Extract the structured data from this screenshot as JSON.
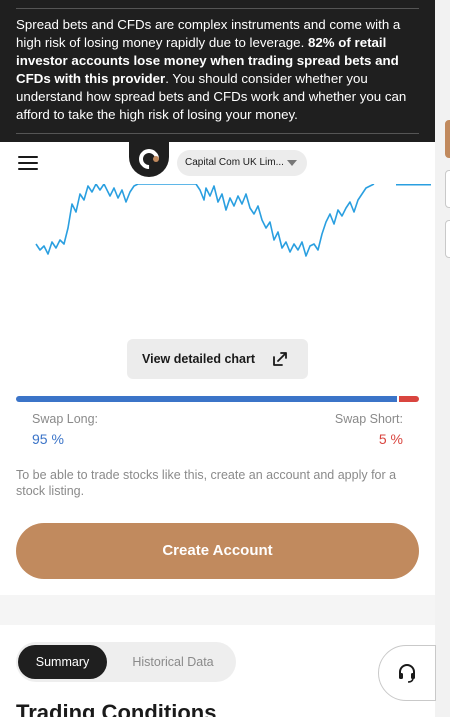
{
  "risk_warning": {
    "text_before": "Spread bets and CFDs are complex instruments and come with a high risk of losing money rapidly due to leverage. ",
    "text_bold": "82% of retail investor accounts lose money when trading spread bets and CFDs with this provider",
    "text_after": ". You should consider whether you understand how spread bets and CFDs work and whether you can afford to take the high risk of losing your money."
  },
  "header": {
    "menu_icon": "hamburger-icon",
    "logo_icon": "capital-com-logo",
    "entity_select": "Capital Com UK Lim..."
  },
  "chart": {
    "line_color": "#2a9fe0"
  },
  "view_chart_button": {
    "label": "View detailed chart",
    "icon": "external-link-icon"
  },
  "swap": {
    "long_label": "Swap Long:",
    "long_value": "95 %",
    "long_fraction": 0.95,
    "short_label": "Swap Short:",
    "short_value": "5 %",
    "short_fraction": 0.05,
    "long_color": "#3b74c8",
    "short_color": "#d9453f"
  },
  "trade_note": "To be able to trade stocks like this, create an account and apply for a stock listing.",
  "create_account_button": "Create Account",
  "tabs": [
    {
      "label": "Summary",
      "active": true
    },
    {
      "label": "Historical Data",
      "active": false
    }
  ],
  "section_title": "Trading Conditions",
  "support": {
    "icon": "headset-icon"
  },
  "colors": {
    "brand": "#c18a5e",
    "banner_bg": "#1f1f1f"
  }
}
